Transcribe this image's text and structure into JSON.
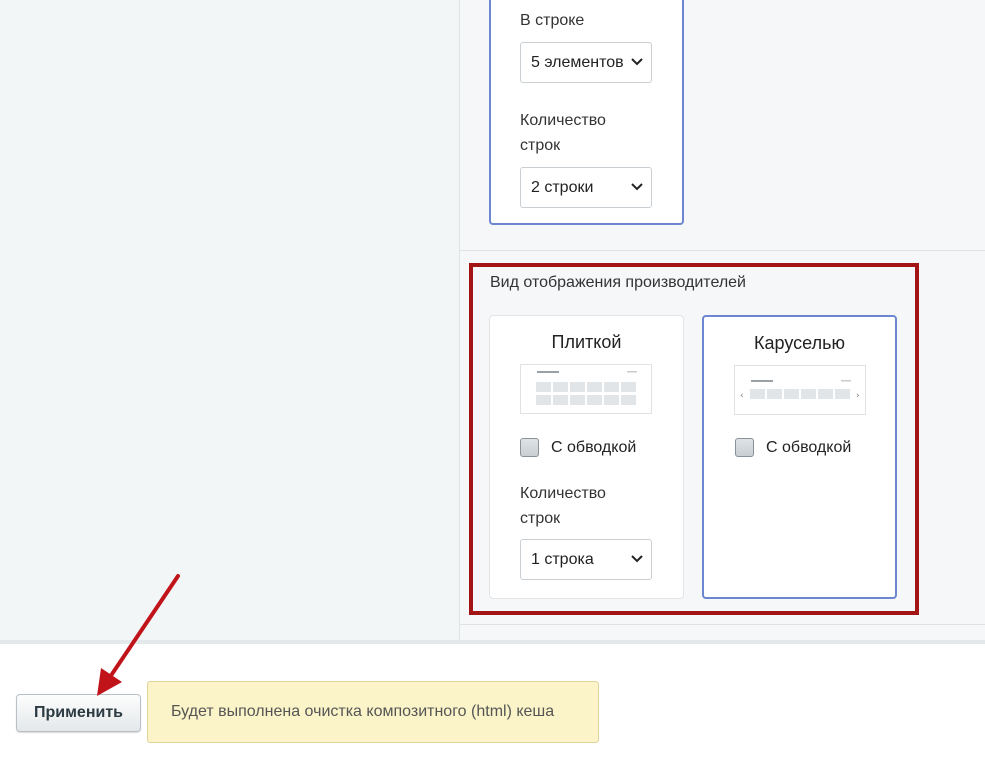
{
  "items_per_row": {
    "label": "В строке",
    "selected": "5 элементов"
  },
  "rows_count_top": {
    "label_line1": "Количество",
    "label_line2": "строк",
    "selected": "2 строки"
  },
  "brands_display": {
    "title": "Вид отображения производителей",
    "tile_option": {
      "title": "Плиткой",
      "border_checkbox_label": "С обводкой",
      "rows_label_line1": "Количество",
      "rows_label_line2": "строк",
      "rows_selected": "1 строка"
    },
    "carousel_option": {
      "title": "Каруселью",
      "border_checkbox_label": "С обводкой"
    }
  },
  "footer": {
    "apply_label": "Применить",
    "notice": "Будет выполнена очистка композитного (html) кеша"
  },
  "colors": {
    "highlight": "#a31515",
    "selected_border": "#6d86d1",
    "notice_bg": "#fbf4c9"
  }
}
